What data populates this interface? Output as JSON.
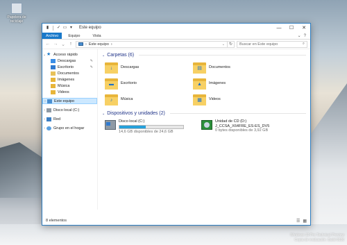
{
  "desktop": {
    "icon_label": "Papelera de reciclaje",
    "watermark_line1": "Windows 10 Pro Technical Preview",
    "watermark_line2": "Copia de evaluación. Build 9926"
  },
  "window": {
    "title": "Este equipo",
    "controls": {
      "minimize": "—",
      "maximize": "☐",
      "close": "✕"
    }
  },
  "ribbon": {
    "tabs": [
      {
        "label": "Archivo"
      },
      {
        "label": "Equipo"
      },
      {
        "label": "Vista"
      }
    ]
  },
  "address": {
    "path": "Este equipo",
    "search_placeholder": "Buscar en Este equipo"
  },
  "nav": {
    "quick_access": "Acceso rápido",
    "quick_items": [
      {
        "label": "Descargas",
        "pinned": true
      },
      {
        "label": "Escritorio",
        "pinned": true
      },
      {
        "label": "Documentos",
        "pinned": false
      },
      {
        "label": "Imágenes",
        "pinned": false
      },
      {
        "label": "Música",
        "pinned": false
      },
      {
        "label": "Videos",
        "pinned": false
      }
    ],
    "this_pc": "Este equipo",
    "local_disk": "Disco local (C:)",
    "network": "Red",
    "homegroup": "Grupo en el hogar"
  },
  "folders_group": {
    "title": "Carpetas (6)",
    "items": [
      {
        "label": "Descargas",
        "icon": "download-icon"
      },
      {
        "label": "Documentos",
        "icon": "document-icon"
      },
      {
        "label": "Escritorio",
        "icon": "desktop-icon"
      },
      {
        "label": "Imágenes",
        "icon": "pictures-icon"
      },
      {
        "label": "Música",
        "icon": "music-icon"
      },
      {
        "label": "Videos",
        "icon": "video-icon"
      }
    ]
  },
  "drives_group": {
    "title": "Dispositivos y unidades (2)",
    "local": {
      "name": "Disco local (C:)",
      "free": "14,6 GB disponibles de 24,6 GB",
      "used_fraction": 0.41
    },
    "cd": {
      "name": "Unidad de CD (D:)",
      "label": "J_CCSA_X64FRE_ES-ES_DV5",
      "free": "0 bytes disponibles de 3,92 GB"
    }
  },
  "status": {
    "count": "8 elementos"
  },
  "colors": {
    "accent": "#1979ca",
    "header": "#1e3287",
    "selection": "#cce8ff",
    "progress": "#26a0da"
  }
}
